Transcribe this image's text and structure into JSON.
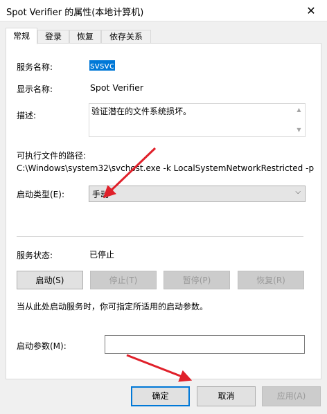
{
  "window": {
    "title": "Spot Verifier 的属性(本地计算机)",
    "close_icon": "close-icon"
  },
  "tabs": [
    {
      "label": "常规",
      "active": true
    },
    {
      "label": "登录",
      "active": false
    },
    {
      "label": "恢复",
      "active": false
    },
    {
      "label": "依存关系",
      "active": false
    }
  ],
  "general": {
    "service_name_label": "服务名称:",
    "service_name": "svsvc",
    "display_name_label": "显示名称:",
    "display_name": "Spot Verifier",
    "description_label": "描述:",
    "description": "验证潜在的文件系统损坏。",
    "exe_path_label": "可执行文件的路径:",
    "exe_path": "C:\\Windows\\system32\\svchost.exe -k LocalSystemNetworkRestricted -p",
    "startup_type_label": "启动类型(E):",
    "startup_type": "手动",
    "status_label": "服务状态:",
    "status": "已停止",
    "buttons": {
      "start": "启动(S)",
      "stop": "停止(T)",
      "pause": "暂停(P)",
      "resume": "恢复(R)"
    },
    "hint": "当从此处启动服务时，你可指定所适用的启动参数。",
    "params_label": "启动参数(M):",
    "params_value": ""
  },
  "footer": {
    "ok": "确定",
    "cancel": "取消",
    "apply": "应用(A)"
  },
  "colors": {
    "accent": "#0078d7",
    "annotation_arrow": "#e0202a"
  }
}
